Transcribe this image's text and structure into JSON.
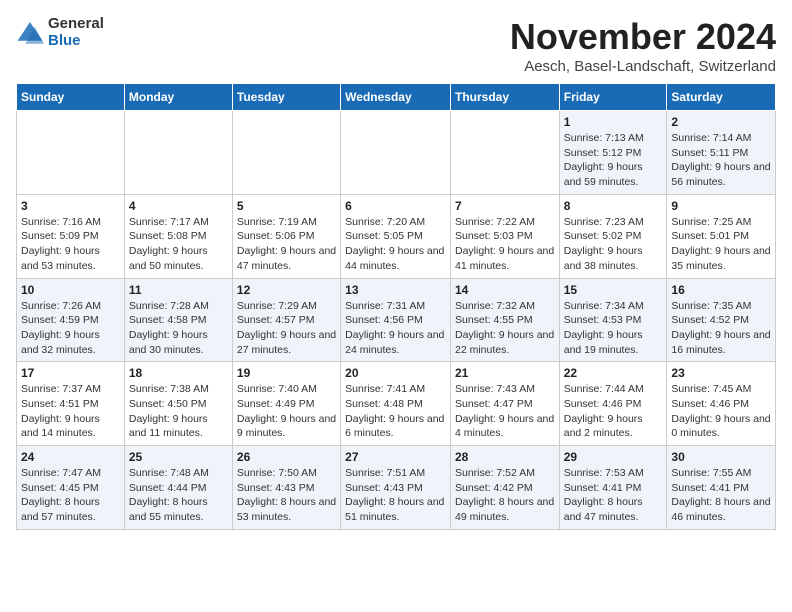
{
  "logo": {
    "general": "General",
    "blue": "Blue"
  },
  "header": {
    "month": "November 2024",
    "location": "Aesch, Basel-Landschaft, Switzerland"
  },
  "weekdays": [
    "Sunday",
    "Monday",
    "Tuesday",
    "Wednesday",
    "Thursday",
    "Friday",
    "Saturday"
  ],
  "weeks": [
    [
      {
        "day": "",
        "info": ""
      },
      {
        "day": "",
        "info": ""
      },
      {
        "day": "",
        "info": ""
      },
      {
        "day": "",
        "info": ""
      },
      {
        "day": "",
        "info": ""
      },
      {
        "day": "1",
        "info": "Sunrise: 7:13 AM\nSunset: 5:12 PM\nDaylight: 9 hours and 59 minutes."
      },
      {
        "day": "2",
        "info": "Sunrise: 7:14 AM\nSunset: 5:11 PM\nDaylight: 9 hours and 56 minutes."
      }
    ],
    [
      {
        "day": "3",
        "info": "Sunrise: 7:16 AM\nSunset: 5:09 PM\nDaylight: 9 hours and 53 minutes."
      },
      {
        "day": "4",
        "info": "Sunrise: 7:17 AM\nSunset: 5:08 PM\nDaylight: 9 hours and 50 minutes."
      },
      {
        "day": "5",
        "info": "Sunrise: 7:19 AM\nSunset: 5:06 PM\nDaylight: 9 hours and 47 minutes."
      },
      {
        "day": "6",
        "info": "Sunrise: 7:20 AM\nSunset: 5:05 PM\nDaylight: 9 hours and 44 minutes."
      },
      {
        "day": "7",
        "info": "Sunrise: 7:22 AM\nSunset: 5:03 PM\nDaylight: 9 hours and 41 minutes."
      },
      {
        "day": "8",
        "info": "Sunrise: 7:23 AM\nSunset: 5:02 PM\nDaylight: 9 hours and 38 minutes."
      },
      {
        "day": "9",
        "info": "Sunrise: 7:25 AM\nSunset: 5:01 PM\nDaylight: 9 hours and 35 minutes."
      }
    ],
    [
      {
        "day": "10",
        "info": "Sunrise: 7:26 AM\nSunset: 4:59 PM\nDaylight: 9 hours and 32 minutes."
      },
      {
        "day": "11",
        "info": "Sunrise: 7:28 AM\nSunset: 4:58 PM\nDaylight: 9 hours and 30 minutes."
      },
      {
        "day": "12",
        "info": "Sunrise: 7:29 AM\nSunset: 4:57 PM\nDaylight: 9 hours and 27 minutes."
      },
      {
        "day": "13",
        "info": "Sunrise: 7:31 AM\nSunset: 4:56 PM\nDaylight: 9 hours and 24 minutes."
      },
      {
        "day": "14",
        "info": "Sunrise: 7:32 AM\nSunset: 4:55 PM\nDaylight: 9 hours and 22 minutes."
      },
      {
        "day": "15",
        "info": "Sunrise: 7:34 AM\nSunset: 4:53 PM\nDaylight: 9 hours and 19 minutes."
      },
      {
        "day": "16",
        "info": "Sunrise: 7:35 AM\nSunset: 4:52 PM\nDaylight: 9 hours and 16 minutes."
      }
    ],
    [
      {
        "day": "17",
        "info": "Sunrise: 7:37 AM\nSunset: 4:51 PM\nDaylight: 9 hours and 14 minutes."
      },
      {
        "day": "18",
        "info": "Sunrise: 7:38 AM\nSunset: 4:50 PM\nDaylight: 9 hours and 11 minutes."
      },
      {
        "day": "19",
        "info": "Sunrise: 7:40 AM\nSunset: 4:49 PM\nDaylight: 9 hours and 9 minutes."
      },
      {
        "day": "20",
        "info": "Sunrise: 7:41 AM\nSunset: 4:48 PM\nDaylight: 9 hours and 6 minutes."
      },
      {
        "day": "21",
        "info": "Sunrise: 7:43 AM\nSunset: 4:47 PM\nDaylight: 9 hours and 4 minutes."
      },
      {
        "day": "22",
        "info": "Sunrise: 7:44 AM\nSunset: 4:46 PM\nDaylight: 9 hours and 2 minutes."
      },
      {
        "day": "23",
        "info": "Sunrise: 7:45 AM\nSunset: 4:46 PM\nDaylight: 9 hours and 0 minutes."
      }
    ],
    [
      {
        "day": "24",
        "info": "Sunrise: 7:47 AM\nSunset: 4:45 PM\nDaylight: 8 hours and 57 minutes."
      },
      {
        "day": "25",
        "info": "Sunrise: 7:48 AM\nSunset: 4:44 PM\nDaylight: 8 hours and 55 minutes."
      },
      {
        "day": "26",
        "info": "Sunrise: 7:50 AM\nSunset: 4:43 PM\nDaylight: 8 hours and 53 minutes."
      },
      {
        "day": "27",
        "info": "Sunrise: 7:51 AM\nSunset: 4:43 PM\nDaylight: 8 hours and 51 minutes."
      },
      {
        "day": "28",
        "info": "Sunrise: 7:52 AM\nSunset: 4:42 PM\nDaylight: 8 hours and 49 minutes."
      },
      {
        "day": "29",
        "info": "Sunrise: 7:53 AM\nSunset: 4:41 PM\nDaylight: 8 hours and 47 minutes."
      },
      {
        "day": "30",
        "info": "Sunrise: 7:55 AM\nSunset: 4:41 PM\nDaylight: 8 hours and 46 minutes."
      }
    ]
  ]
}
